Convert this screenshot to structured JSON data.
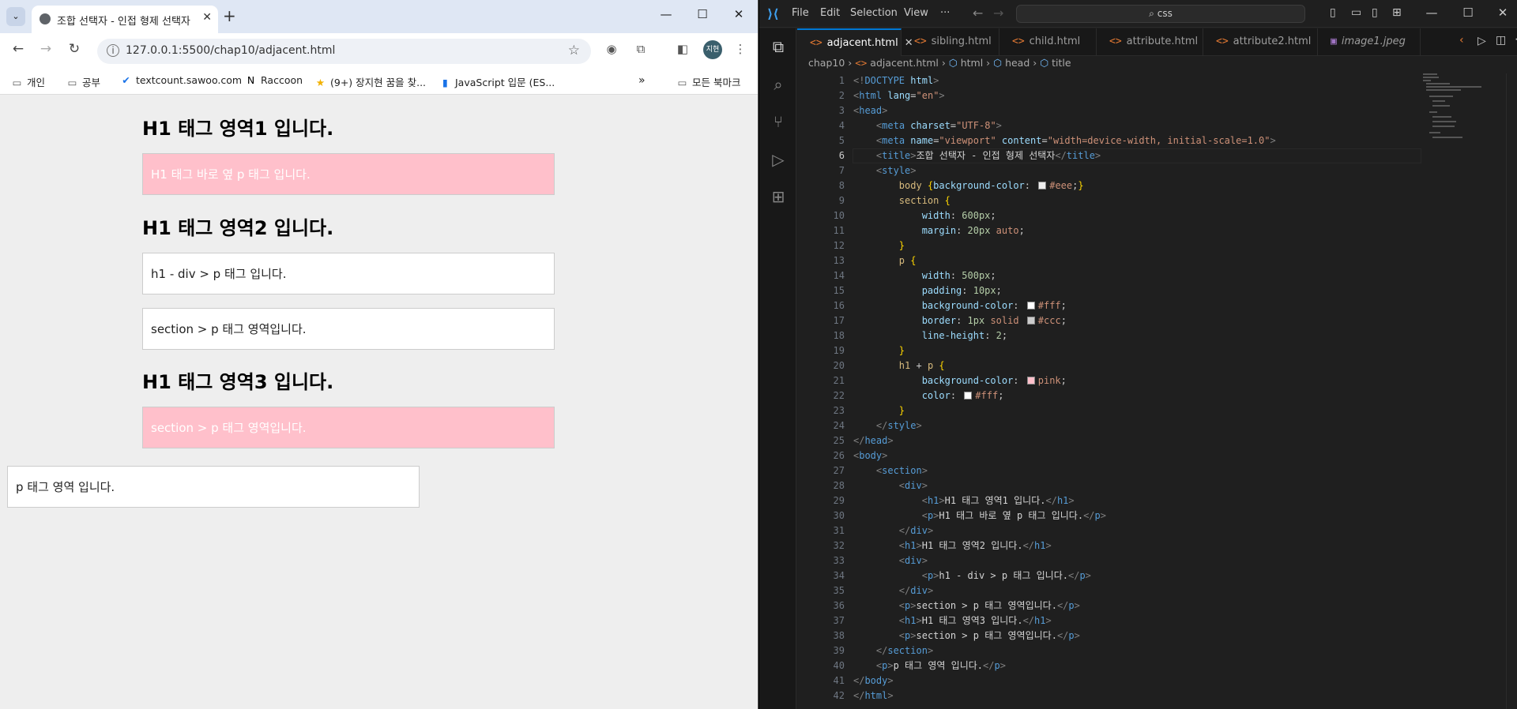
{
  "browser": {
    "tab_title": "조합 선택자 - 인접 형제 선택자",
    "url": "127.0.0.1:5500/chap10/adjacent.html",
    "profile_initials": "지현",
    "bookmarks": [
      "개인",
      "공부",
      "textcount.sawoo.com",
      "Raccoon",
      "(9+) 장지현 꿈을 찾...",
      "JavaScript 입문 (ES...",
      "모든 북마크"
    ],
    "page": {
      "h1_1": "H1 태그 영역1 입니다.",
      "p_1": "H1 태그 바로 옆 p 태그 입니다.",
      "h1_2": "H1 태그 영역2 입니다.",
      "p_2": "h1 - div > p 태그 입니다.",
      "p_3": "section > p 태그 영역입니다.",
      "h1_3": "H1 태그 영역3 입니다.",
      "p_4": "section > p 태그 영역입니다.",
      "p_5": "p 태그 영역 입니다."
    }
  },
  "vscode": {
    "menu": [
      "File",
      "Edit",
      "Selection",
      "View",
      "···"
    ],
    "search_text": "css",
    "tabs": [
      "adjacent.html",
      "sibling.html",
      "child.html",
      "attribute.html",
      "attribute2.html",
      "image1.jpeg"
    ],
    "active_tab": "adjacent.html",
    "breadcrumb": [
      "chap10",
      "adjacent.html",
      "html",
      "head",
      "title"
    ],
    "current_line": 6,
    "colors": {
      "body_bg": "#eee",
      "p_bg": "#fff",
      "p_border": "#ccc",
      "pink": "pink",
      "text_white": "#fff"
    }
  }
}
